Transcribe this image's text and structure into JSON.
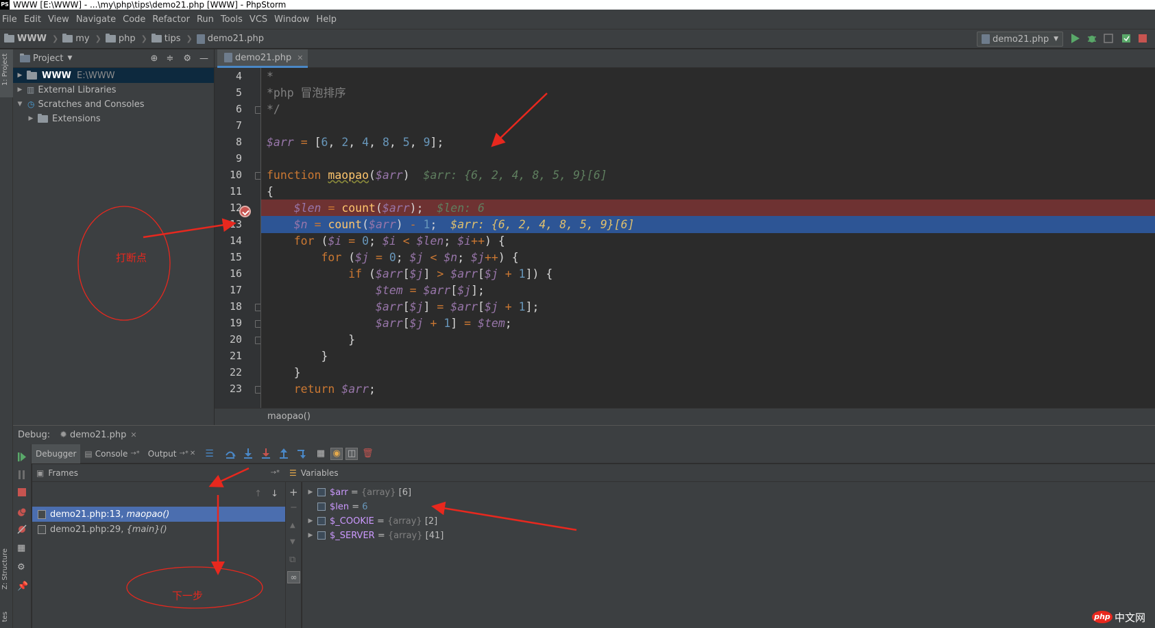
{
  "window": {
    "title": "WWW [E:\\WWW] - ...\\my\\php\\tips\\demo21.php [WWW] - PhpStorm",
    "logo": "PS"
  },
  "menu": [
    "File",
    "Edit",
    "View",
    "Navigate",
    "Code",
    "Refactor",
    "Run",
    "Tools",
    "VCS",
    "Window",
    "Help"
  ],
  "breadcrumbs": [
    "WWW",
    "my",
    "php",
    "tips",
    "demo21.php"
  ],
  "run_config": "demo21.php",
  "left_strip": {
    "project": "1: Project",
    "structure": "Z: Structure",
    "favorites": "tes"
  },
  "project": {
    "title": "Project",
    "tree": [
      {
        "label": "WWW",
        "path": "E:\\WWW",
        "expanded": false,
        "selected": true
      },
      {
        "label": "External Libraries"
      },
      {
        "label": "Scratches and Consoles",
        "expanded": true
      },
      {
        "label": "Extensions"
      }
    ]
  },
  "editor": {
    "tab": "demo21.php",
    "lines": [
      {
        "n": "4",
        "code": "*"
      },
      {
        "n": "5",
        "code": "*php 冒泡排序"
      },
      {
        "n": "6",
        "code": "*/"
      },
      {
        "n": "7",
        "code": ""
      },
      {
        "n": "8",
        "code": "$arr = [6, 2, 4, 8, 5, 9];"
      },
      {
        "n": "9",
        "code": ""
      },
      {
        "n": "10",
        "code": "function maopao($arr)",
        "hint": "$arr: {6, 2, 4, 8, 5, 9}[6]"
      },
      {
        "n": "11",
        "code": "{"
      },
      {
        "n": "12",
        "code": "    $len = count($arr);",
        "hint": "$len: 6"
      },
      {
        "n": "13",
        "code": "    $n = count($arr) - 1;",
        "hint": "$arr: {6, 2, 4, 8, 5, 9}[6]"
      },
      {
        "n": "14",
        "code": "    for ($i = 0; $i < $len; $i++) {"
      },
      {
        "n": "15",
        "code": "        for ($j = 0; $j < $n; $j++) {"
      },
      {
        "n": "16",
        "code": "            if ($arr[$j] > $arr[$j + 1]) {"
      },
      {
        "n": "17",
        "code": "                $tem = $arr[$j];"
      },
      {
        "n": "18",
        "code": "                $arr[$j] = $arr[$j + 1];"
      },
      {
        "n": "19",
        "code": "                $arr[$j + 1] = $tem;"
      },
      {
        "n": "20",
        "code": "            }"
      },
      {
        "n": "21",
        "code": "        }"
      },
      {
        "n": "22",
        "code": "    }"
      },
      {
        "n": "23",
        "code": "    return $arr;"
      }
    ],
    "breadcrumb": "maopao()"
  },
  "debug": {
    "label": "Debug:",
    "session": "demo21.php",
    "tabs": [
      "Debugger",
      "Console",
      "Output"
    ],
    "frames_title": "Frames",
    "variables_title": "Variables",
    "frames": [
      {
        "file": "demo21.php:13,",
        "fn": "maopao()"
      },
      {
        "file": "demo21.php:29,",
        "fn": "{main}()"
      }
    ],
    "variables": [
      {
        "name": "$arr",
        "type": "{array}",
        "value": "[6]",
        "expandable": true
      },
      {
        "name": "$len",
        "type": "",
        "value": "6",
        "expandable": false
      },
      {
        "name": "$_COOKIE",
        "type": "{array}",
        "value": "[2]",
        "expandable": true
      },
      {
        "name": "$_SERVER",
        "type": "{array}",
        "value": "[41]",
        "expandable": true
      }
    ]
  },
  "annotations": {
    "breakpoint_note": "打断点",
    "step_note": "下一步"
  },
  "watermark": {
    "php": "php",
    "cn": "中文网"
  },
  "colors": {
    "breakpoint_line": "#6e3232",
    "exec_line": "#2d5595",
    "annotation": "#e8281e",
    "selection": "#4b6eaf"
  }
}
